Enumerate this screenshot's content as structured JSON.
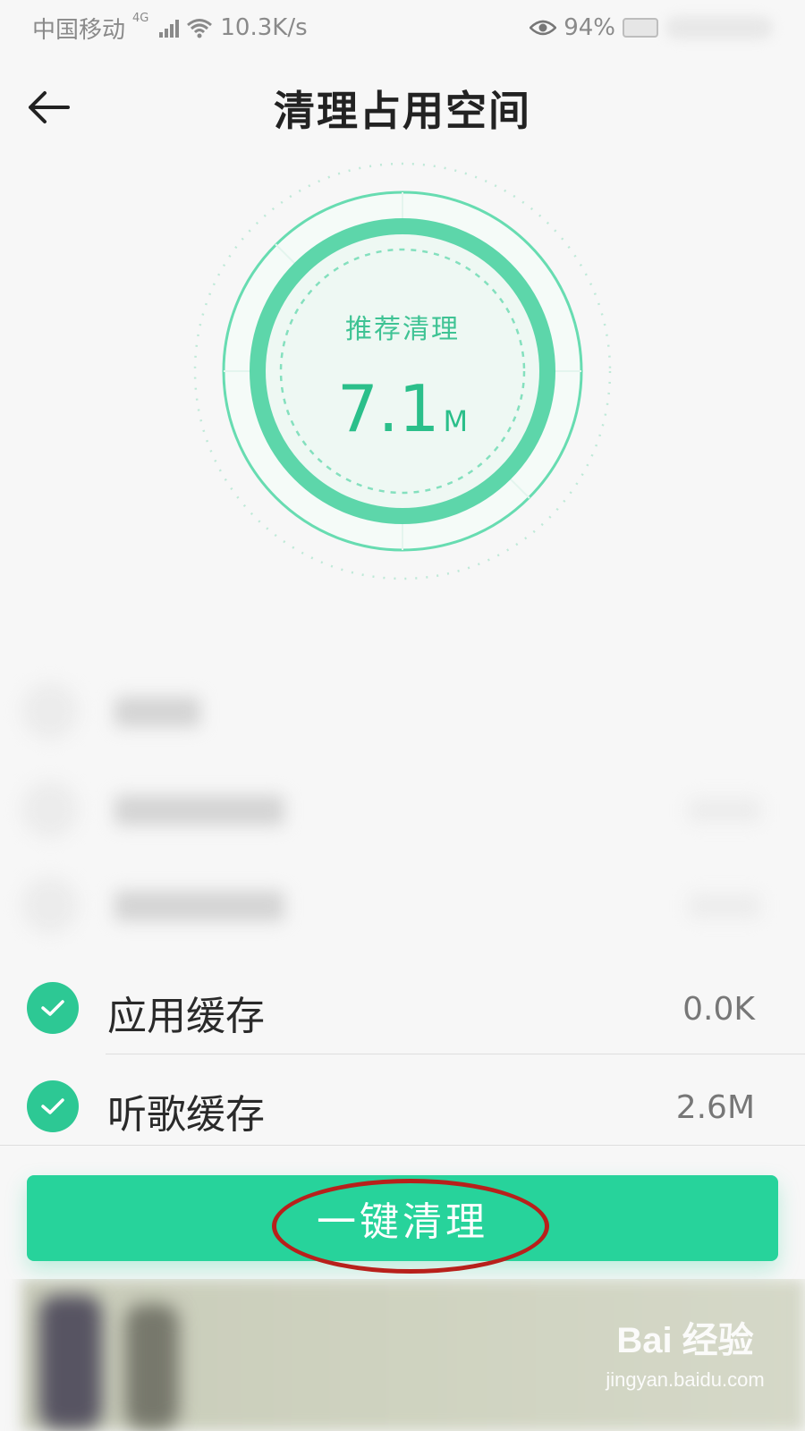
{
  "status_bar": {
    "carrier": "中国移动",
    "network_type": "4G",
    "speed": "10.3K/s",
    "battery": "94%"
  },
  "header": {
    "title": "清理占用空间"
  },
  "gauge": {
    "label": "推荐清理",
    "value": "7.1",
    "unit": "M"
  },
  "cache_items": [
    {
      "label": "应用缓存",
      "size": "0.0K",
      "checked": true
    },
    {
      "label": "听歌缓存",
      "size": "2.6M",
      "checked": true
    }
  ],
  "actions": {
    "clean_label": "一键清理"
  },
  "watermark": {
    "logo": "Bai 经验",
    "sub": "jingyan.baidu.com"
  },
  "colors": {
    "accent": "#27d39b",
    "gauge_text": "#2bbf8a",
    "annotation": "#b8201b"
  }
}
